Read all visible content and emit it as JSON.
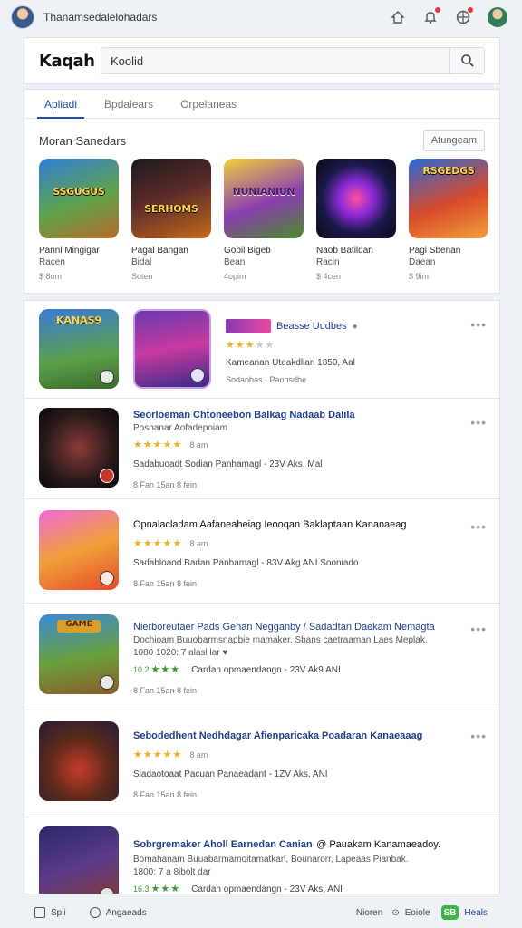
{
  "topbar": {
    "title": "Thanamsedalelohadars",
    "icons": [
      "home-icon",
      "bell-icon",
      "grid-icon"
    ]
  },
  "search": {
    "logo": "Kaqah",
    "value": "Koolid",
    "button_icon": "search-icon"
  },
  "tabs": [
    {
      "label": "Apliadi",
      "active": true
    },
    {
      "label": "Bpdalears",
      "active": false
    },
    {
      "label": "Orpelaneas",
      "active": false
    }
  ],
  "featured": {
    "title": "Moran Sanedars",
    "see_all": "Atungeam",
    "items": [
      {
        "name": "Pannl Mingigar",
        "name2": "Racen",
        "price": "$ 8om",
        "overlay": "SSGUGUS"
      },
      {
        "name": "Pagal Bangan",
        "name2": "Bidal",
        "price": "Soten",
        "overlay": "SERHOMS"
      },
      {
        "name": "Gobil Bigeb",
        "name2": "Bean",
        "price": "4opim",
        "overlay": "NUNIANIUN"
      },
      {
        "name": "Naob Batildan",
        "name2": "Racin",
        "price": "$ 4cen",
        "overlay": ""
      },
      {
        "name": "Pagi Sbenan",
        "name2": "Daean",
        "price": "$ 9im",
        "overlay": "RSGEDGS"
      }
    ]
  },
  "list": [
    {
      "title": "Beasse Uudbes",
      "sub": "",
      "stars": 3,
      "rating_text": "",
      "meta": "Kameanan Uteakdlian 1850, Aal",
      "foot": "Sodaobas · Pannsdbe",
      "overlay": "KANAS9"
    },
    {
      "title": "Seorloeman Chtoneebon Balkag Nadaab Dalila",
      "sub": "Posoanar Aofadepoiam",
      "stars": 5,
      "rating_text": "8 am",
      "meta": "Sadabuoadt  Sodian Panhamagl -  23V Aks, Mal",
      "foot": "8 Fan   15an   8 fein",
      "overlay": ""
    },
    {
      "title": "Opnalacladam Aafaneaheiag Ieooqan Baklaptaan Kananaeag",
      "sub": "",
      "stars": 5,
      "rating_text": "8 am",
      "meta": "Sadabloaod  Badan Panhamagl -  83V Akg ANI        Sooniado",
      "foot": "8 Fan   15an   8 fein",
      "overlay": ""
    },
    {
      "title": "Nierboreutaer Pads Gehan Negganby  /  Sadadtan Daekam Nemagta",
      "sub": "Dochioam Buuobarmsnapbie mamaker, Sbans caetraaman Laes Meplak.",
      "sub2": "1080 1020: 7 alasl lar ♥",
      "stars": 3,
      "rating_text": "10.2",
      "meta": "Cardan opmaendangn -  23V Ak9 ANI",
      "foot": "8 Fan   15an   8 fein",
      "overlay": "GAME"
    },
    {
      "title": "Sebodedhent Nedhdagar Afienparicaka Poadaran Kanaeaaag",
      "sub": "",
      "stars": 5,
      "rating_text": "8 am",
      "meta": "Sladaotoaat  Pacuan Panaeadant -  1ZV Aks, ANI",
      "foot": "8 Fan   15an   8 fein",
      "overlay": ""
    },
    {
      "title": "Sobrgremaker Aholl Earnedan Canian",
      "title2": "@ Pauakam Kanamaeadoy.",
      "sub": "Bomahanam Buuabarmamoitamatkan, Bounarorr, Lapeaas Pianbak.",
      "sub2": "1800: 7 a 8ibolt dar",
      "stars": 3,
      "rating_text": "16.3",
      "meta": "Cardan opmaendangn -  23V Aks, ANI",
      "foot": "",
      "overlay": ""
    }
  ],
  "bottombar": {
    "left1": "Spli",
    "left2": "Angaeads",
    "right1": "Nioren",
    "right2": "Eoiole",
    "badge": "SB",
    "right3": "Heals"
  }
}
